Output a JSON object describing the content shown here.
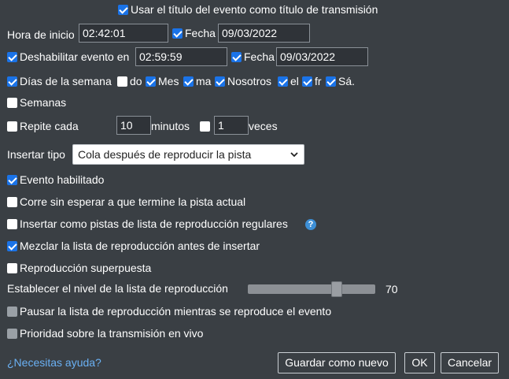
{
  "use_event_title": {
    "label": "Usar el título del evento como título de transmisión",
    "checked": true
  },
  "start": {
    "label": "Hora de inicio",
    "time": "02:42:01",
    "date_checked": true,
    "date_label": "Fecha",
    "date": "09/03/2022"
  },
  "disable": {
    "checked": true,
    "label": "Deshabilitar evento en",
    "time": "02:59:59",
    "date_checked": true,
    "date_label": "Fecha",
    "date": "09/03/2022"
  },
  "weekdays": {
    "checked": true,
    "label": "Días de la semana",
    "days": [
      {
        "label": "do",
        "checked": false
      },
      {
        "label": "Mes",
        "checked": true
      },
      {
        "label": "ma",
        "checked": true
      },
      {
        "label": "Nosotros",
        "checked": true
      },
      {
        "label": "el",
        "checked": true
      },
      {
        "label": "fr",
        "checked": true
      },
      {
        "label": "Sá.",
        "checked": true
      }
    ]
  },
  "weeks": {
    "label": "Semanas",
    "checked": false
  },
  "repeat": {
    "checked": false,
    "label": "Repite cada",
    "minutes_value": "10",
    "minutes_label": "minutos",
    "times_checked": false,
    "times_value": "1",
    "times_label": "veces"
  },
  "insert_type": {
    "label": "Insertar tipo",
    "selected": "Cola después de reproducir la pista"
  },
  "options": {
    "enabled": {
      "label": "Evento habilitado",
      "checked": true
    },
    "no_wait": {
      "label": "Corre sin esperar a que termine la pista actual",
      "checked": false
    },
    "regular_tracks": {
      "label": "Insertar como pistas de lista de reproducción regulares",
      "checked": false
    },
    "shuffle": {
      "label": "Mezclar la lista de reproducción antes de insertar",
      "checked": true
    },
    "overlap": {
      "label": "Reproducción superpuesta",
      "checked": false
    }
  },
  "playlist_level": {
    "label": "Establecer el nivel de la lista de reproducción",
    "value": "70",
    "fraction": 0.7
  },
  "pause_playlist": {
    "label": "Pausar la lista de reproducción mientras se reproduce el evento",
    "checked": false,
    "disabled": true
  },
  "priority_live": {
    "label": "Prioridad sobre la transmisión en vivo",
    "checked": false,
    "disabled": true
  },
  "footer": {
    "help_link": "¿Necesitas ayuda?",
    "help_icon": "?",
    "save_new": "Guardar como nuevo",
    "ok": "OK",
    "cancel": "Cancelar"
  },
  "colors": {
    "background": "#3a3f44",
    "accent": "#1a73e8",
    "link": "#6ab0f3"
  }
}
